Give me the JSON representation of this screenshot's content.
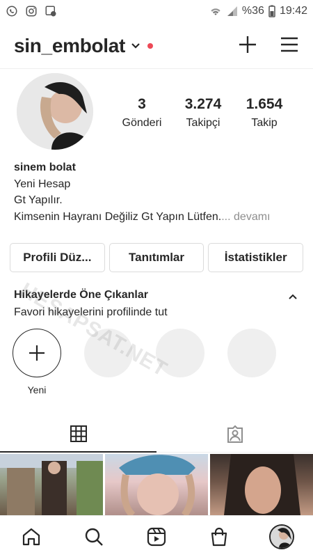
{
  "status_bar": {
    "left_icons": [
      "whatsapp-icon",
      "instagram-icon",
      "gallery-icon"
    ],
    "battery": "%36",
    "time": "19:42"
  },
  "header": {
    "username": "sin_embolat",
    "icons": [
      "chevron-down-icon",
      "notification-dot",
      "plus-icon",
      "menu-icon"
    ],
    "accent_color": "#ed4956"
  },
  "profile": {
    "stats": [
      {
        "value": "3",
        "label": "Gönderi"
      },
      {
        "value": "3.274",
        "label": "Takipçi"
      },
      {
        "value": "1.654",
        "label": "Takip"
      }
    ],
    "name": "sinem bolat",
    "bio_lines": [
      "Yeni Hesap",
      "Gt Yapılır.",
      "Kimsenin Hayranı Değiliz Gt Yapın Lütfen."
    ],
    "more_label": "... devamı"
  },
  "buttons": [
    {
      "label": "Profili Düz..."
    },
    {
      "label": "Tanıtımlar"
    },
    {
      "label": "İstatistikler"
    }
  ],
  "highlights": {
    "title": "Hikayelerde Öne Çıkanlar",
    "subtitle": "Favori hikayelerini profilinde tut",
    "new_label": "Yeni",
    "empty_count": 3
  },
  "tabs": [
    "grid-icon",
    "tagged-icon"
  ],
  "watermark": "HESAPSAT.NET",
  "bottom_nav": [
    "home-icon",
    "search-icon",
    "reels-icon",
    "shop-icon",
    "profile-avatar"
  ]
}
